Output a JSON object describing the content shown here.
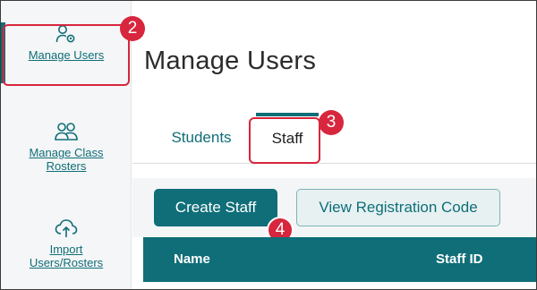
{
  "sidebar": {
    "items": [
      {
        "label": "Manage Users",
        "icon": "user-gear-icon",
        "active": true
      },
      {
        "label": "Manage Class Rosters",
        "icon": "users-icon",
        "active": false
      },
      {
        "label": "Import Users/Rosters",
        "icon": "cloud-upload-icon",
        "active": false
      }
    ]
  },
  "page": {
    "title": "Manage Users"
  },
  "tabs": [
    {
      "label": "Students",
      "selected": false
    },
    {
      "label": "Staff",
      "selected": true
    }
  ],
  "toolbar": {
    "create_label": "Create Staff",
    "view_code_label": "View Registration Code"
  },
  "table": {
    "columns": [
      "Name",
      "Staff ID"
    ]
  },
  "callouts": [
    "2",
    "3",
    "4"
  ],
  "colors": {
    "accent": "#0f6e78",
    "callout": "#d7263d"
  }
}
